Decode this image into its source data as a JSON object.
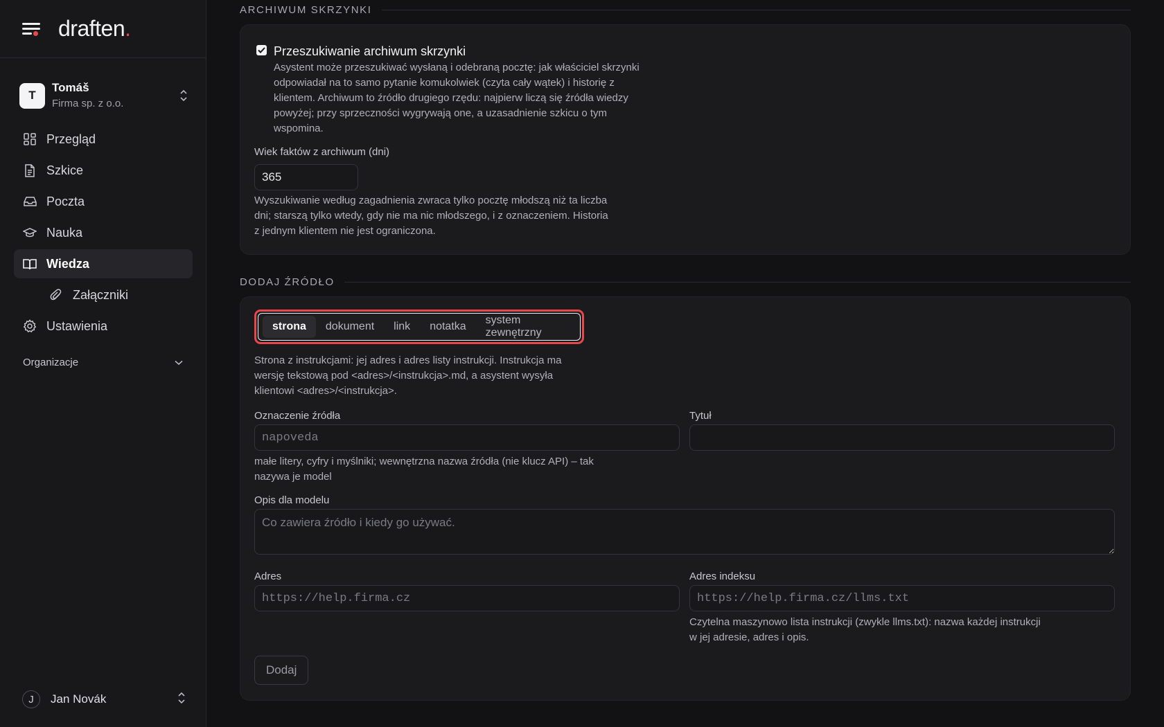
{
  "app": {
    "logo_text": "draften",
    "logo_dot": ".",
    "accent_color": "#e5484d"
  },
  "org": {
    "initial": "T",
    "name": "Tomáš",
    "company": "Firma sp. z o.o."
  },
  "nav": {
    "items": [
      {
        "label": "Przegląd",
        "icon": "grid-icon"
      },
      {
        "label": "Szkice",
        "icon": "document-icon"
      },
      {
        "label": "Poczta",
        "icon": "inbox-icon"
      },
      {
        "label": "Nauka",
        "icon": "graduation-cap-icon"
      },
      {
        "label": "Wiedza",
        "icon": "book-icon",
        "active": true
      },
      {
        "label": "Załączniki",
        "icon": "paperclip-icon",
        "sub": true
      },
      {
        "label": "Ustawienia",
        "icon": "gear-icon"
      }
    ],
    "group_label": "Organizacje"
  },
  "user": {
    "initial": "J",
    "name": "Jan Novák"
  },
  "archive": {
    "section_title": "ARCHIWUM SKRZYNKI",
    "checkbox_label": "Przeszukiwanie archiwum skrzynki",
    "checkbox_checked": true,
    "checkbox_help": "Asystent może przeszukiwać wysłaną i odebraną pocztę: jak właściciel skrzynki odpowiadał na to samo pytanie komukolwiek (czyta cały wątek) i historię z klientem. Archiwum to źródło drugiego rzędu: najpierw liczą się źródła wiedzy powyżej; przy sprzeczności wygrywają one, a uzasadnienie szkicu o tym wspomina.",
    "age_label": "Wiek faktów z archiwum (dni)",
    "age_value": "365",
    "age_help": "Wyszukiwanie według zagadnienia zwraca tylko pocztę młodszą niż ta liczba dni; starszą tylko wtedy, gdy nie ma nic młodszego, i z oznaczeniem. Historia z jednym klientem nie jest ograniczona."
  },
  "add_source": {
    "section_title": "DODAJ ŹRÓDŁO",
    "tabs": [
      "strona",
      "dokument",
      "link",
      "notatka",
      "system zewnętrzny"
    ],
    "active_tab": "strona",
    "tab_help": "Strona z instrukcjami: jej adres i adres listy instrukcji. Instrukcja ma wersję tekstową pod <adres>/<instrukcja>.md, a asystent wysyła klientowi <adres>/<instrukcja>.",
    "id_label": "Oznaczenie źródła",
    "id_placeholder": "napoveda",
    "id_help": "małe litery, cyfry i myślniki; wewnętrzna nazwa źródła (nie klucz API) – tak nazywa je model",
    "title_label": "Tytuł",
    "title_value": "",
    "desc_label": "Opis dla modelu",
    "desc_placeholder": "Co zawiera źródło i kiedy go używać.",
    "url_label": "Adres",
    "url_placeholder": "https://help.firma.cz",
    "index_label": "Adres indeksu",
    "index_placeholder": "https://help.firma.cz/llms.txt",
    "index_help": "Czytelna maszynowo lista instrukcji (zwykle llms.txt): nazwa każdej instrukcji w jej adresie, adres i opis.",
    "submit_label": "Dodaj"
  }
}
